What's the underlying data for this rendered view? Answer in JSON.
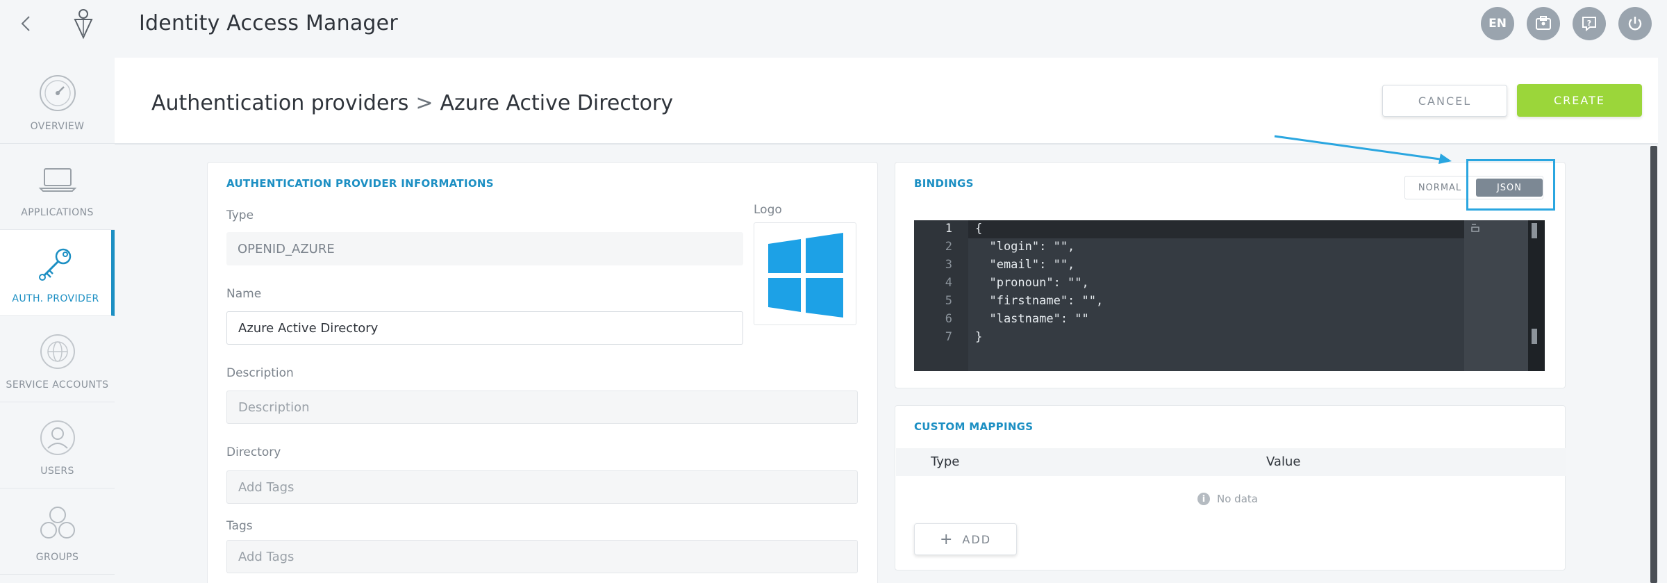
{
  "app": {
    "title": "Identity Access Manager"
  },
  "topbar": {
    "lang": "EN",
    "icons": [
      "back-icon",
      "app-logo",
      "id-card-icon",
      "help-icon",
      "power-icon"
    ]
  },
  "sidebar": {
    "items": [
      {
        "label": "OVERVIEW",
        "icon": "dashboard-icon"
      },
      {
        "label": "APPLICATIONS",
        "icon": "laptop-icon"
      },
      {
        "label": "AUTH. PROVIDER",
        "icon": "key-icon",
        "active": true
      },
      {
        "label": "SERVICE ACCOUNTS",
        "icon": "globe-icon"
      },
      {
        "label": "USERS",
        "icon": "user-icon"
      },
      {
        "label": "GROUPS",
        "icon": "group-icon"
      }
    ]
  },
  "header": {
    "crumb_parent": "Authentication providers",
    "crumb_sep": ">",
    "crumb_current": "Azure Active Directory",
    "cancel_label": "CANCEL",
    "create_label": "CREATE"
  },
  "info_card": {
    "title": "AUTHENTICATION PROVIDER INFORMATIONS",
    "type_label": "Type",
    "type_value": "OPENID_AZURE",
    "logo_label": "Logo",
    "name_label": "Name",
    "name_value": "Azure Active Directory",
    "description_label": "Description",
    "description_placeholder": "Description",
    "directory_label": "Directory",
    "directory_placeholder": "Add Tags",
    "tags_label": "Tags",
    "tags_placeholder": "Add Tags"
  },
  "bindings": {
    "title": "BINDINGS",
    "normal_label": "NORMAL",
    "json_label": "JSON",
    "lines": [
      {
        "n": "1",
        "text": "{"
      },
      {
        "n": "2",
        "text": "  \"login\": \"\","
      },
      {
        "n": "3",
        "text": "  \"email\": \"\","
      },
      {
        "n": "4",
        "text": "  \"pronoun\": \"\","
      },
      {
        "n": "5",
        "text": "  \"firstname\": \"\","
      },
      {
        "n": "6",
        "text": "  \"lastname\": \"\""
      },
      {
        "n": "7",
        "text": "}"
      }
    ]
  },
  "mappings": {
    "title": "CUSTOM MAPPINGS",
    "col_type": "Type",
    "col_value": "Value",
    "no_data": "No data",
    "add_label": "ADD"
  },
  "colors": {
    "accent": "#1c8fc3",
    "create": "#9bd63a",
    "highlight": "#2aa6e0"
  }
}
